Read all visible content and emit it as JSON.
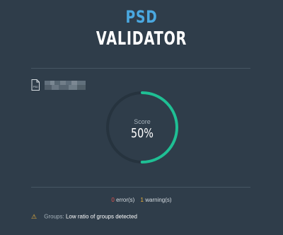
{
  "header": {
    "title_top": "PSD",
    "title_bottom": "VALIDATOR"
  },
  "file": {
    "icon": "psd-file-icon",
    "icon_label": "PSD"
  },
  "score": {
    "label": "Score",
    "value_text": "50%",
    "value": 0.5
  },
  "summary": {
    "errors_count": "0",
    "errors_label": "error(s)",
    "warnings_count": "1",
    "warnings_label": "warning(s)"
  },
  "issues": [
    {
      "icon": "warning-icon",
      "category": "Groups:",
      "message": "Low ratio of groups detected"
    }
  ],
  "colors": {
    "background": "#2f3d4a",
    "accent_blue": "#4aa8e0",
    "gauge_fill": "#1fbf94",
    "gauge_track": "#26333e",
    "error": "#e0524d",
    "warning": "#f0b43a"
  }
}
